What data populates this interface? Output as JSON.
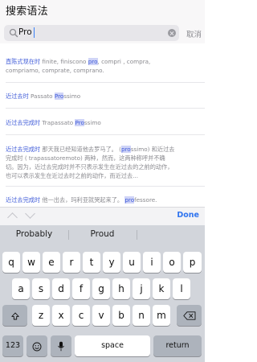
{
  "header": {
    "title": "搜索语法"
  },
  "search": {
    "value": "Pro",
    "cancel_label": "取消"
  },
  "results": [
    {
      "tag": "直陈式现在时",
      "pre": " finite, finiscono ",
      "hl": "pro",
      "post": ", compri , compra,",
      "line2": "compriamo, comprate, comprano."
    },
    {
      "tag": "近过去时",
      "pre": " Passato ",
      "hl": "Pro",
      "post": "ssimo"
    },
    {
      "tag": "近过去完成时",
      "pre": " Trapassato ",
      "hl": "Pro",
      "post": "ssimo"
    },
    {
      "tag": "近过去完成时",
      "l1_pre": " 那天我已经知道他去罗马了。 (",
      "l1_hl": "pro",
      "l1_post": "ssimo) 和近过去",
      "line2": "完成时 ( trapassatoremoto) 两种，然而，这两种称呼并不确",
      "line3": "切。因为，近过去完成时并不只表示发生在近过去的之前的动作，",
      "line4": "也可以表示发生在近过去时之前的动作，而近过去..."
    },
    {
      "tag": "近过去完成时",
      "pre": " 他一出去，玛利亚就哭起来了。 ",
      "hl": "pro",
      "post": "fessore."
    }
  ],
  "accessory": {
    "done_label": "Done"
  },
  "keyboard": {
    "suggestions": [
      "Probably",
      "Proud",
      ""
    ],
    "row1": [
      "q",
      "w",
      "e",
      "r",
      "t",
      "y",
      "u",
      "i",
      "o",
      "p"
    ],
    "row2": [
      "a",
      "s",
      "d",
      "f",
      "g",
      "h",
      "j",
      "k",
      "l"
    ],
    "row3": [
      "z",
      "x",
      "c",
      "v",
      "b",
      "n",
      "m"
    ],
    "numbers_label": "123",
    "space_label": "space",
    "return_label": "return"
  },
  "colors": {
    "accent": "#2f74ef",
    "tag": "#3f5bd8",
    "highlight": "#cfd4f7"
  }
}
